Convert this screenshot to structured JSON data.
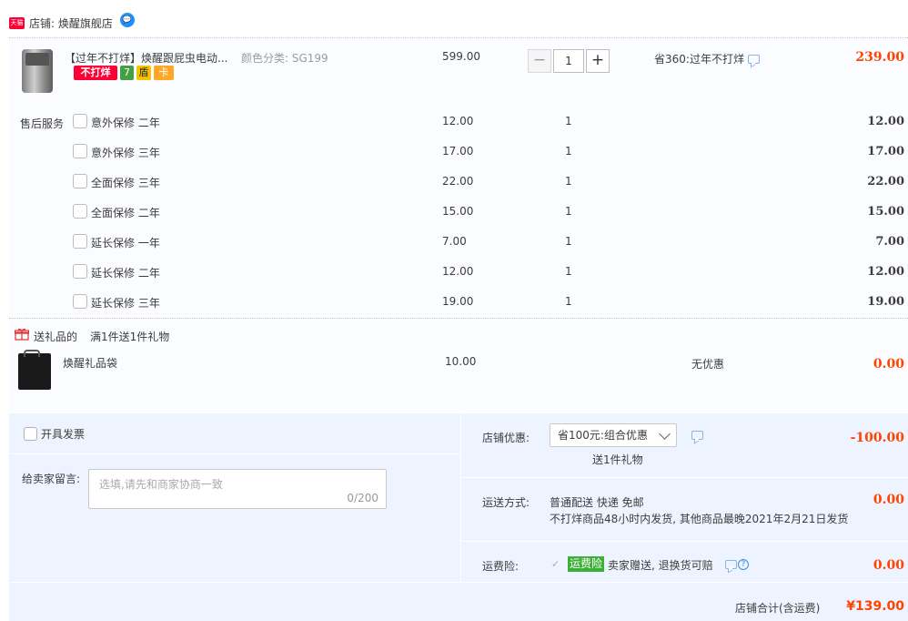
{
  "shop": {
    "tmall_badge": "天猫",
    "label": "店铺: 焕醒旗舰店",
    "chat_icon": "wangwang-chat-icon"
  },
  "product": {
    "title": "【过年不打烊】焕醒跟屁虫电动...",
    "sku": "颜色分类: SG199",
    "tags": [
      "不打烊",
      "7",
      "盾",
      "卡"
    ],
    "unit_price": "599.00",
    "quantity": "1",
    "minus": "−",
    "plus": "+",
    "discount_text": "省360:过年不打烊",
    "subtotal": "239.00"
  },
  "services": {
    "label": "售后服务",
    "items": [
      {
        "name": "意外保修 二年",
        "price": "12.00",
        "qty": "1",
        "total": "12.00"
      },
      {
        "name": "意外保修 三年",
        "price": "17.00",
        "qty": "1",
        "total": "17.00"
      },
      {
        "name": "全面保修 三年",
        "price": "22.00",
        "qty": "1",
        "total": "22.00"
      },
      {
        "name": "全面保修 二年",
        "price": "15.00",
        "qty": "1",
        "total": "15.00"
      },
      {
        "name": "延长保修 一年",
        "price": "7.00",
        "qty": "1",
        "total": "7.00"
      },
      {
        "name": "延长保修 二年",
        "price": "12.00",
        "qty": "1",
        "total": "12.00"
      },
      {
        "name": "延长保修 三年",
        "price": "19.00",
        "qty": "1",
        "total": "19.00"
      }
    ]
  },
  "gift": {
    "label": "送礼品的",
    "rule": "满1件送1件礼物",
    "name": "焕醒礼品袋",
    "price": "10.00",
    "discount": "无优惠",
    "total": "0.00"
  },
  "footer": {
    "invoice_label": "开具发票",
    "message_label": "给卖家留言:",
    "message_placeholder": "选填,请先和商家协商一致",
    "message_count": "0/200",
    "shop_discount_label": "店铺优惠:",
    "coupon_selected": "省100元:组合优惠",
    "gift_note": "送1件礼物",
    "shop_discount_value": "-100.00",
    "shipping_label": "运送方式:",
    "shipping_type": "普通配送 快递 免邮",
    "shipping_note": "不打烊商品48小时内发货, 其他商品最晚2021年2月21日发货",
    "shipping_value": "0.00",
    "insurance_label": "运费险:",
    "insurance_tag": "运费险",
    "insurance_text": "卖家赠送, 退换货可赔",
    "insurance_value": "0.00"
  },
  "total": {
    "label": "店铺合计(含运费)",
    "value": "¥139.00"
  },
  "colors": {
    "price_red": "#ff4400",
    "tmall_red": "#ff0036",
    "footer_bg": "#eef4ff",
    "insurance_green": "#3cb034"
  }
}
